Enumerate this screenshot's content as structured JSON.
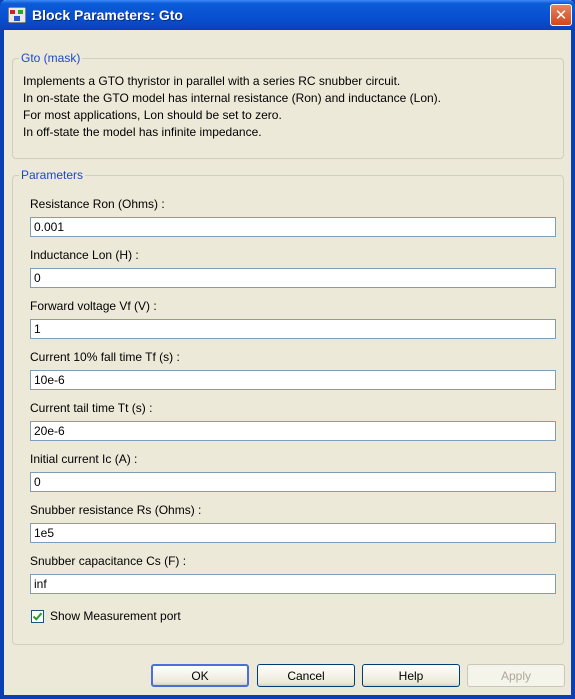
{
  "window": {
    "title": "Block Parameters: Gto",
    "close_glyph": "✕",
    "app_icon": "simulink-block-icon"
  },
  "mask": {
    "legend": "Gto (mask)",
    "description": [
      "Implements a GTO thyristor in parallel with a series RC snubber circuit.",
      "In on-state the GTO model has internal resistance (Ron) and inductance (Lon).",
      "For most applications, Lon should be set to zero.",
      "In off-state the model has infinite impedance."
    ]
  },
  "parameters": {
    "legend": "Parameters",
    "fields": [
      {
        "label": "Resistance Ron (Ohms) :",
        "value": "0.001"
      },
      {
        "label": "Inductance Lon (H) :",
        "value": "0"
      },
      {
        "label": "Forward voltage Vf (V) :",
        "value": "1"
      },
      {
        "label": "Current 10% fall time Tf (s) :",
        "value": "10e-6"
      },
      {
        "label": "Current tail time Tt (s) :",
        "value": "20e-6"
      },
      {
        "label": "Initial current Ic (A) :",
        "value": "0"
      },
      {
        "label": "Snubber resistance Rs (Ohms) :",
        "value": "1e5"
      },
      {
        "label": "Snubber capacitance Cs (F) :",
        "value": "inf"
      }
    ],
    "show_measurement": {
      "label": "Show Measurement port",
      "checked": true
    }
  },
  "buttons": {
    "ok": "OK",
    "cancel": "Cancel",
    "help": "Help",
    "apply": "Apply"
  },
  "colors": {
    "titlebar": "#0850d0",
    "legend_text": "#1c49c7",
    "dialog_bg": "#ece9d8",
    "checkmark": "#21a121"
  }
}
